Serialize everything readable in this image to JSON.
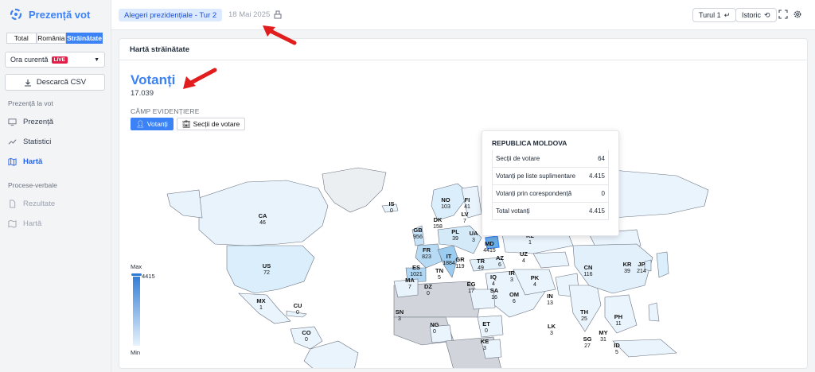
{
  "app": {
    "title": "Prezență vot"
  },
  "tabs": [
    "Total",
    "România",
    "Străinătate"
  ],
  "active_tab": "Străinătate",
  "time_select": {
    "value": "Ora curentă",
    "badge": "LIVE"
  },
  "download_label": "Descarcă CSV",
  "sections": {
    "presence": "Prezență la vot",
    "records": "Procese-verbale"
  },
  "nav": [
    {
      "label": "Prezență",
      "icon": "monitor-icon"
    },
    {
      "label": "Statistici",
      "icon": "trend-icon"
    },
    {
      "label": "Hartă",
      "icon": "map-icon"
    }
  ],
  "nav_records": [
    {
      "label": "Rezultate",
      "icon": "document-icon"
    },
    {
      "label": "Hartă",
      "icon": "map-icon"
    }
  ],
  "topbar": {
    "election": "Alegeri prezidențiale - Tur 2",
    "date": "18 Mai 2025",
    "round_button": "Turul 1",
    "history_button": "Istoric"
  },
  "card": {
    "header": "Hartă străinătate",
    "metric_title": "Votanți",
    "metric_value": "17.039",
    "field_label": "CÂMP EVIDENȚIERE",
    "chip_votanti": "Votanți",
    "chip_sectii": "Secții de votare"
  },
  "legend": {
    "max": "Max",
    "min": "Min",
    "value": "4415"
  },
  "tooltip": {
    "title": "REPUBLICA MOLDOVA",
    "rows": [
      {
        "label": "Secții de votare",
        "value": "64"
      },
      {
        "label": "Votanți pe liste suplimentare",
        "value": "4.415"
      },
      {
        "label": "Votanți prin corespondență",
        "value": "0"
      },
      {
        "label": "Total votanți",
        "value": "4.415"
      }
    ]
  },
  "map_labels": [
    {
      "code": "CA",
      "value": "46"
    },
    {
      "code": "US",
      "value": "72"
    },
    {
      "code": "MX",
      "value": "1"
    },
    {
      "code": "CU",
      "value": "0"
    },
    {
      "code": "CO",
      "value": "0"
    },
    {
      "code": "IS",
      "value": "0"
    },
    {
      "code": "NO",
      "value": "103"
    },
    {
      "code": "FI",
      "value": "41"
    },
    {
      "code": "DK",
      "value": "158"
    },
    {
      "code": "GB",
      "value": "956"
    },
    {
      "code": "FR",
      "value": "823"
    },
    {
      "code": "ES",
      "value": "1021"
    },
    {
      "code": "IT",
      "value": "1884"
    },
    {
      "code": "PL",
      "value": "39"
    },
    {
      "code": "LV",
      "value": "7"
    },
    {
      "code": "UA",
      "value": "3"
    },
    {
      "code": "MD",
      "value": "4415"
    },
    {
      "code": "TR",
      "value": "49"
    },
    {
      "code": "GR",
      "value": "119"
    },
    {
      "code": "KZ",
      "value": "1"
    },
    {
      "code": "UZ",
      "value": "4"
    },
    {
      "code": "AZ",
      "value": "6"
    },
    {
      "code": "IQ",
      "value": "4"
    },
    {
      "code": "IR",
      "value": "3"
    },
    {
      "code": "SA",
      "value": "16"
    },
    {
      "code": "EG",
      "value": "17"
    },
    {
      "code": "PK",
      "value": "4"
    },
    {
      "code": "OM",
      "value": "6"
    },
    {
      "code": "IN",
      "value": "13"
    },
    {
      "code": "CN",
      "value": "116"
    },
    {
      "code": "KR",
      "value": "39"
    },
    {
      "code": "JP",
      "value": "214"
    },
    {
      "code": "TN",
      "value": "5"
    },
    {
      "code": "MA",
      "value": "7"
    },
    {
      "code": "DZ",
      "value": "0"
    },
    {
      "code": "SN",
      "value": "3"
    },
    {
      "code": "NG",
      "value": "0"
    },
    {
      "code": "ET",
      "value": "0"
    },
    {
      "code": "KE",
      "value": "3"
    },
    {
      "code": "TH",
      "value": "25"
    },
    {
      "code": "LK",
      "value": "3"
    },
    {
      "code": "PH",
      "value": "11"
    },
    {
      "code": "MY",
      "value": "31"
    },
    {
      "code": "SG",
      "value": "27"
    },
    {
      "code": "ID",
      "value": "5"
    }
  ],
  "colors": {
    "accent": "#3b82f6",
    "live": "#e11d48",
    "arrow": "#e11d1d"
  }
}
